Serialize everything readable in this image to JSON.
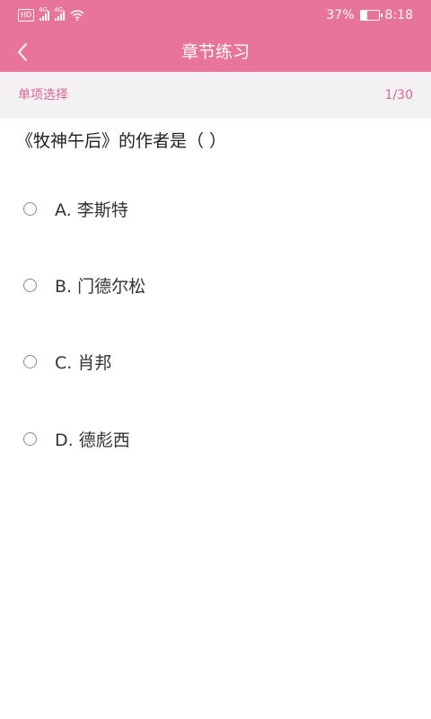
{
  "status_bar": {
    "hd": "HD",
    "network1": "4G",
    "network2": "4G",
    "battery_percent": "37%",
    "battery_level": 0.37,
    "time": "8:18"
  },
  "nav": {
    "title": "章节练习",
    "back_icon": "chevron-left-icon"
  },
  "sub_header": {
    "question_type": "单项选择",
    "progress": "1/30"
  },
  "question": {
    "text": "《牧神午后》的作者是（ ）",
    "options": [
      {
        "label": "A. 李斯特"
      },
      {
        "label": "B. 门德尔松"
      },
      {
        "label": "C. 肖邦"
      },
      {
        "label": "D. 德彪西"
      }
    ]
  },
  "colors": {
    "primary": "#e9749a",
    "accent_text": "#d9678e",
    "sub_header_bg": "#f3f1f3"
  }
}
